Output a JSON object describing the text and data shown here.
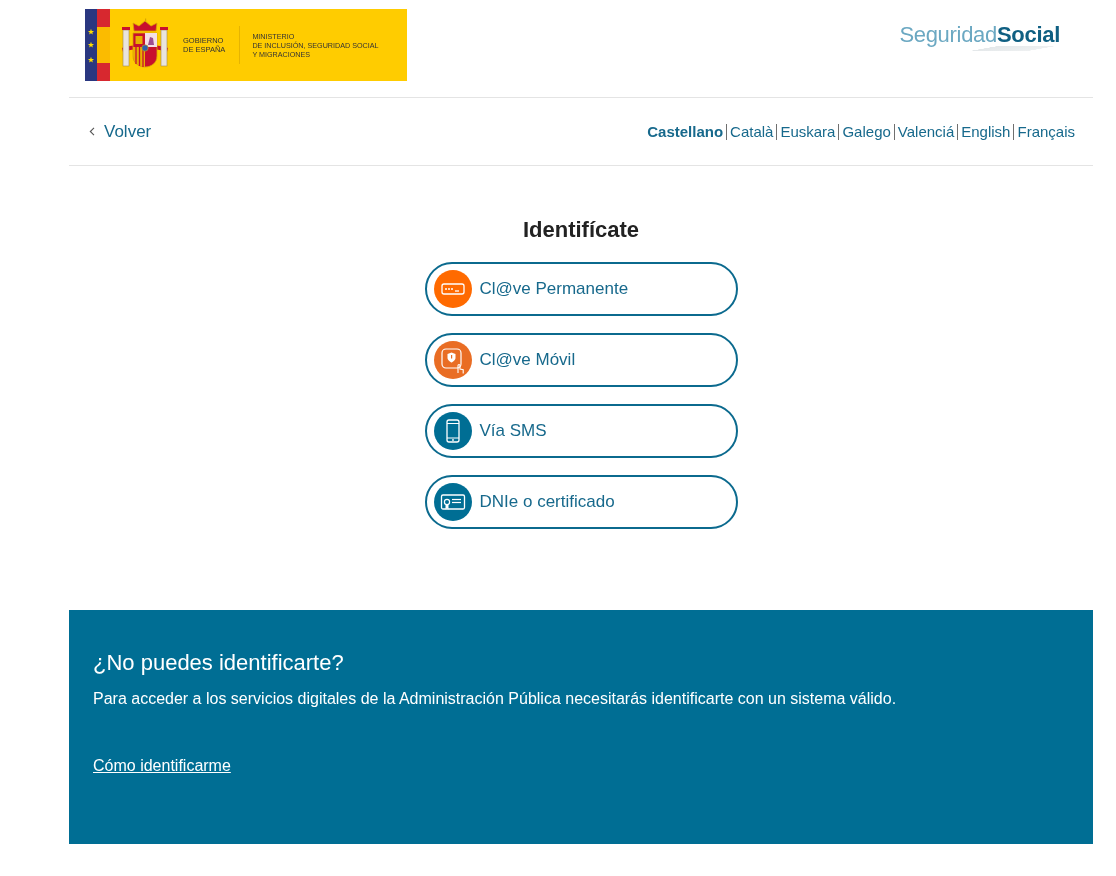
{
  "header": {
    "government_logo": {
      "government_lines": [
        "GOBIERNO",
        "DE ESPAÑA"
      ],
      "ministry_lines": [
        "MINISTERIO",
        "DE INCLUSIÓN, SEGURIDAD SOCIAL",
        "Y MIGRACIONES"
      ]
    },
    "brand_logo": "Seguridad**Social**"
  },
  "nav": {
    "back_link": "Volver",
    "languages": [
      {
        "label": "Castellano",
        "selected": true
      },
      {
        "label": "Català",
        "selected": false
      },
      {
        "label": "Euskara",
        "selected": false
      },
      {
        "label": "Galego",
        "selected": false
      },
      {
        "label": "Valenciá",
        "selected": false
      },
      {
        "label": "English",
        "selected": false
      },
      {
        "label": "Français",
        "selected": false
      }
    ]
  },
  "login": {
    "title": "Identifícate",
    "methods": [
      {
        "kind": "password",
        "label": "Cl@ve Permanente"
      },
      {
        "kind": "mobile-app",
        "label": "Cl@ve Móvil"
      },
      {
        "kind": "phone",
        "label": "Vía SMS"
      },
      {
        "kind": "certificate",
        "label": "DNIe o certificado"
      }
    ]
  },
  "help_panel": {
    "title": "¿No puedes identificarte?",
    "text": "Para acceder a los servicios digitales de la Administración Pública necesitarás identificarte con un sistema válido.",
    "link": "Cómo identificarme"
  }
}
